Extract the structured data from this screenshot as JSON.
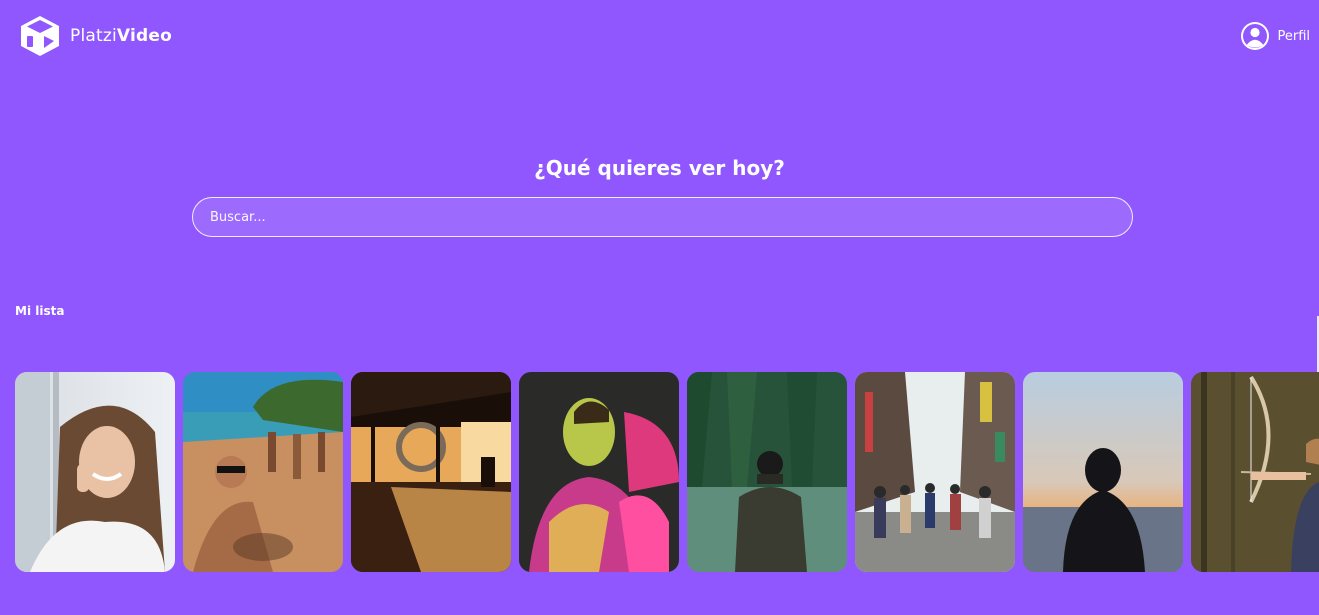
{
  "brand": {
    "part1": "Platzi",
    "part2": "Video",
    "color": "#8f57fd"
  },
  "header": {
    "profile_label": "Perfil"
  },
  "hero": {
    "title": "¿Qué quieres ver hoy?"
  },
  "search": {
    "placeholder": "Buscar..."
  },
  "list": {
    "title": "Mi lista",
    "items": [
      {
        "icon": "woman-on-phone-image"
      },
      {
        "icon": "friends-on-beach-image"
      },
      {
        "icon": "sunset-interior-image"
      },
      {
        "icon": "man-color-powder-image"
      },
      {
        "icon": "man-by-forest-lake-image"
      },
      {
        "icon": "busy-city-street-image"
      },
      {
        "icon": "hooded-person-sunset-image"
      },
      {
        "icon": "girl-archer-forest-image"
      }
    ]
  }
}
